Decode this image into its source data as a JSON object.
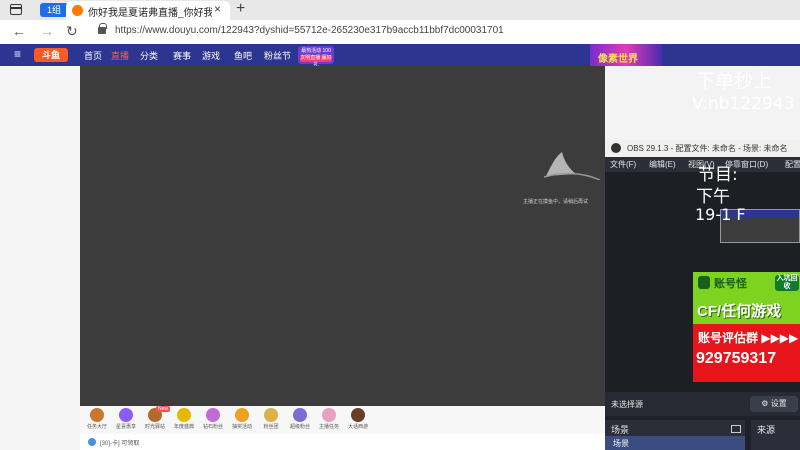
{
  "browser": {
    "group_label": "1组",
    "tab_title": "你好我是夏诺弗直播_你好我是夏",
    "tab_close": "×",
    "new_tab": "+",
    "back": "←",
    "forward": "→",
    "reload": "↻",
    "url": "https://www.douyu.com/122943?dyshid=55712e-265230e317b9accb11bbf7dc00031701"
  },
  "site": {
    "hamburger": "≡",
    "logo": "斗鱼",
    "nav": [
      "首页",
      "直播",
      "分类",
      "赛事",
      "游戏",
      "鱼吧",
      "粉丝节"
    ],
    "promo_line1": "最热活动 100",
    "promo_line2": "文明直播 赢好礼",
    "banner_text": "像素世界"
  },
  "player": {
    "loading_text": "主播正在摸鱼中，请稍后再试"
  },
  "gifts": [
    {
      "label": "任务大厅",
      "color": "#c9772f"
    },
    {
      "label": "星喜惠享",
      "color": "#8b5cf6"
    },
    {
      "label": "时光驿站",
      "color": "#b26a2b"
    },
    {
      "label": "年度盛典",
      "color": "#e6b800"
    },
    {
      "label": "钻石粉丝",
      "color": "#c06bd6"
    },
    {
      "label": "抽奖活动",
      "color": "#f0a020"
    },
    {
      "label": "粉丝团",
      "color": "#d9b24c"
    },
    {
      "label": "超级粉丝",
      "color": "#7c6cd6"
    },
    {
      "label": "主播任务",
      "color": "#e8a0c0"
    },
    {
      "label": "大话西游",
      "color": "#6a3c2a"
    }
  ],
  "gift_new_tag": "New",
  "bottom_text": "[30]-卡] 可领取",
  "overlay": {
    "line1": "下单秒上",
    "line2": "V:nb122943",
    "jiemu": "节目:",
    "xiawu": "下午",
    "time": "19-1  F"
  },
  "obs": {
    "title": "OBS 29.1.3 - 配置文件: 未命名 - 场景: 未命名",
    "menu": [
      "文件(F)",
      "编辑(E)",
      "视图(V)",
      "停靠窗口(D)",
      "配置"
    ],
    "no_source": "未选择源",
    "settings": "⚙ 设置",
    "scenes_header": "场景",
    "scene_item": "场景",
    "sources_header": "来源"
  },
  "ad": {
    "badge": "账号怪",
    "corner": "入坑回收",
    "headline": "CF/任何游戏",
    "group": "账号评估群 ▶▶▶▶",
    "number": "929759317"
  }
}
